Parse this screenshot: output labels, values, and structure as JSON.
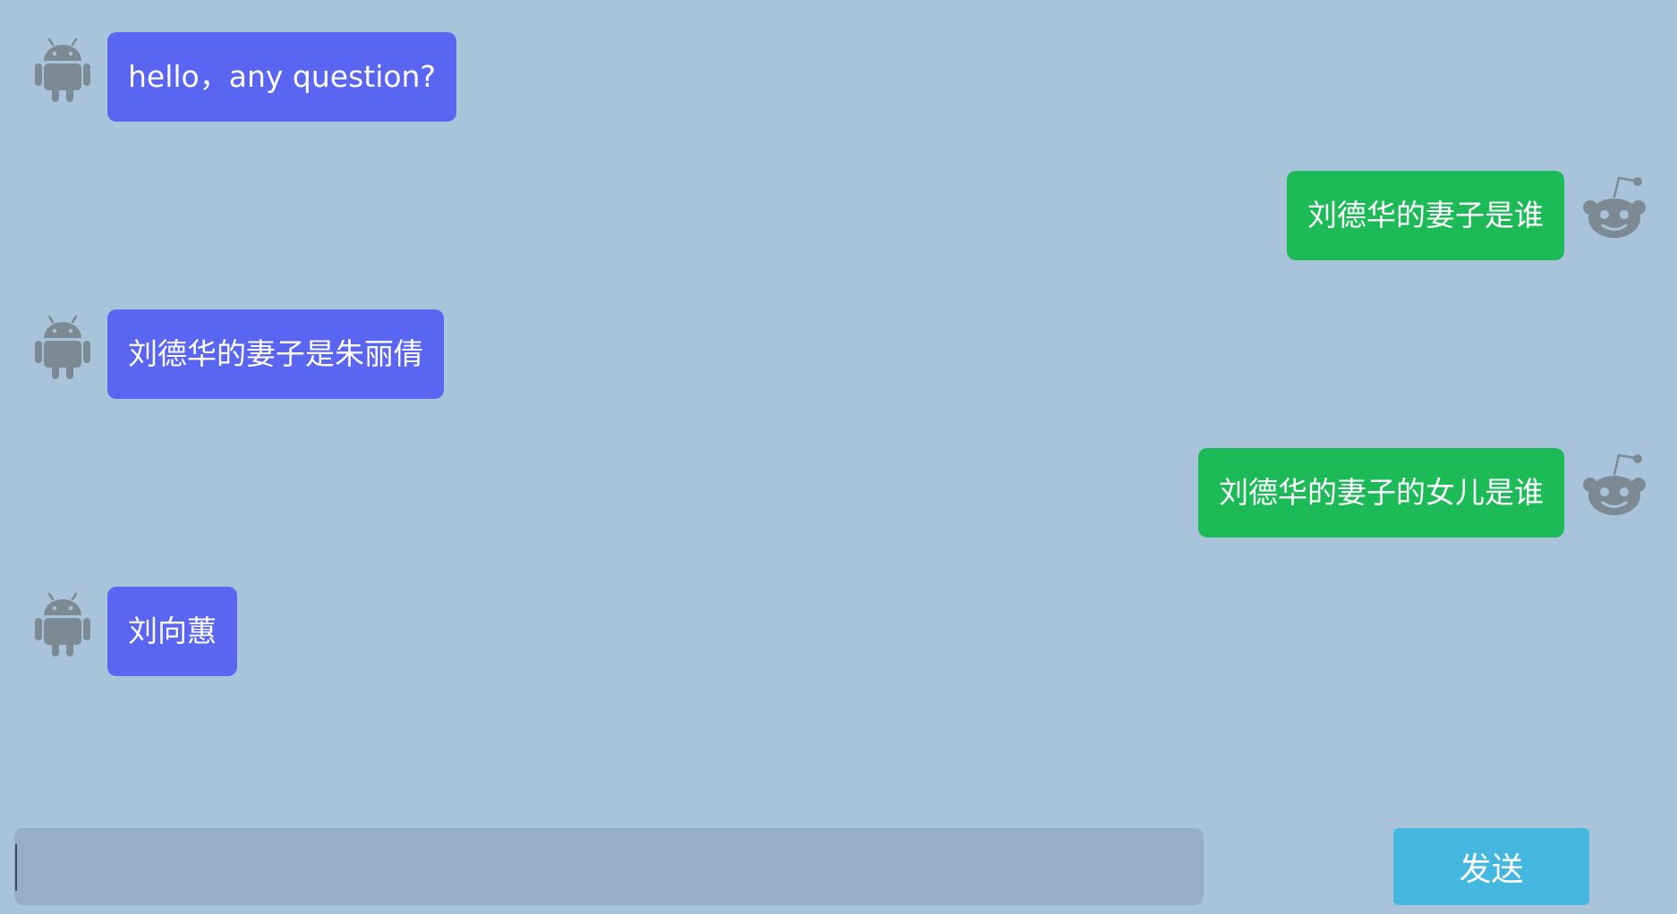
{
  "conversation": {
    "messages": [
      {
        "sender": "bot",
        "avatar_icon": "android-icon",
        "text": "hello，any question?"
      },
      {
        "sender": "user",
        "avatar_icon": "reddit-alien-icon",
        "text": "刘德华的妻子是谁"
      },
      {
        "sender": "bot",
        "avatar_icon": "android-icon",
        "text": "刘德华的妻子是朱丽倩"
      },
      {
        "sender": "user",
        "avatar_icon": "reddit-alien-icon",
        "text": "刘德华的妻子的女儿是谁"
      },
      {
        "sender": "bot",
        "avatar_icon": "android-icon",
        "text": "刘向蕙"
      }
    ]
  },
  "composer": {
    "input_value": "",
    "placeholder": "",
    "send_label": "发送"
  },
  "colors": {
    "background": "#a9c3da",
    "bot_bubble": "#5a66f2",
    "user_bubble": "#1dbb58",
    "input_background": "#97afc5",
    "send_button": "#44b7e0",
    "icon_gray": "#7b8a93"
  }
}
